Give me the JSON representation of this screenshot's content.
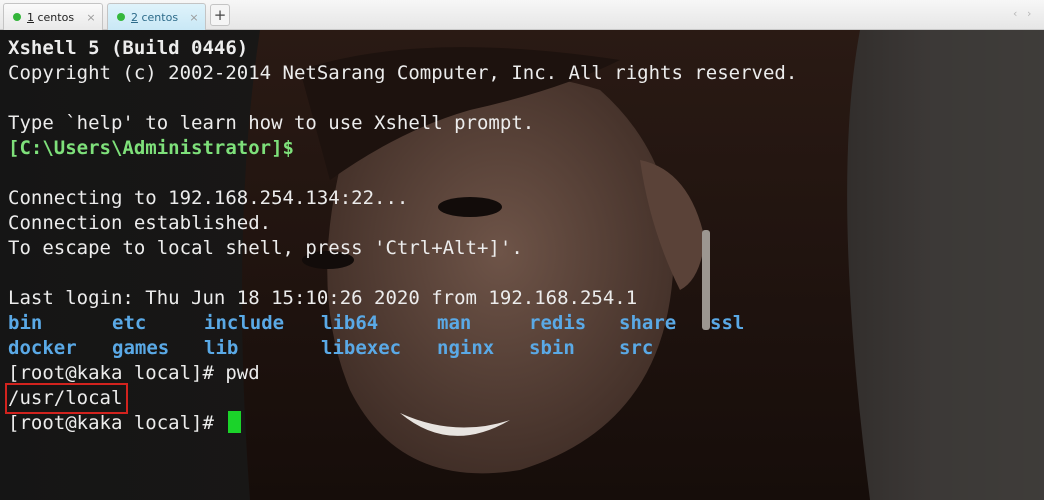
{
  "tabs": [
    {
      "num": "1",
      "label": " centos",
      "active": false,
      "status_color": "#33b53a",
      "close": "×"
    },
    {
      "num": "2",
      "label": " centos",
      "active": true,
      "status_color": "#35b83d",
      "close": "×"
    }
  ],
  "add_tab": "+",
  "nav": {
    "prev": "‹",
    "next": "›"
  },
  "terminal": {
    "banner1": "Xshell 5 (Build 0446)",
    "banner2": "Copyright (c) 2002-2014 NetSarang Computer, Inc. All rights reserved.",
    "help": "Type `help' to learn how to use Xshell prompt.",
    "local_prompt": "[C:\\Users\\Administrator]$",
    "connecting": "Connecting to 192.168.254.134:22...",
    "established": "Connection established.",
    "escape": "To escape to local shell, press 'Ctrl+Alt+]'.",
    "last_login": "Last login: Thu Jun 18 15:10:26 2020 from 192.168.254.1",
    "ls_row1": [
      "bin",
      "etc",
      "include",
      "lib64",
      "man",
      "redis",
      "share",
      "ssl"
    ],
    "ls_row2": [
      "docker",
      "games",
      "lib",
      "libexec",
      "nginx",
      "sbin",
      "src"
    ],
    "cmd_prompt": "[root@kaka local]# pwd",
    "pwd_output": "/usr/local",
    "final_prompt": "[root@kaka local]# "
  },
  "colors": {
    "prompt": "#7ee07a",
    "directory": "#5aa9e6",
    "cursor": "#1bd32a",
    "highlight_box": "#d2231e"
  },
  "icons": {
    "tab_status": "status-dot-icon",
    "close": "close-icon",
    "add": "plus-icon"
  }
}
